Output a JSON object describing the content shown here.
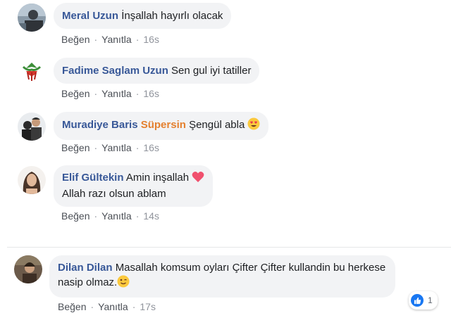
{
  "comments": [
    {
      "author": "Meral Uzun",
      "text": "İnşallah hayırlı olacak",
      "like": "Beğen",
      "reply": "Yanıtla",
      "time": "16s"
    },
    {
      "author": "Fadime Saglam Uzun",
      "text": "Sen gul iyi tatiller",
      "like": "Beğen",
      "reply": "Yanıtla",
      "time": "16s"
    },
    {
      "author": "Muradiye Baris",
      "author_suffix": "Süpersin",
      "text": "Şengül abla",
      "like": "Beğen",
      "reply": "Yanıtla",
      "time": "16s"
    },
    {
      "author": "Elif Gültekin",
      "text_line1": "Amin inşallah",
      "text_line2": "Allah razı olsun ablam",
      "like": "Beğen",
      "reply": "Yanıtla",
      "time": "14s"
    },
    {
      "author": "Dilan Dilan",
      "text_line1": "Masallah komsum oyları Çifter Çifter kullandin bu herkese",
      "text_line2": "nasip olmaz.",
      "like": "Beğen",
      "reply": "Yanıtla",
      "time": "17s",
      "reaction_count": "1"
    }
  ],
  "icons": {
    "heart_eyes": "heart-eyes-emoji",
    "heart": "red-heart-emoji",
    "wink": "winking-face-emoji",
    "like": "like-reaction-icon"
  },
  "colors": {
    "author": "#385898",
    "accent": "#e4802f",
    "bubble": "#f2f3f5",
    "like_blue": "#1877f2"
  }
}
